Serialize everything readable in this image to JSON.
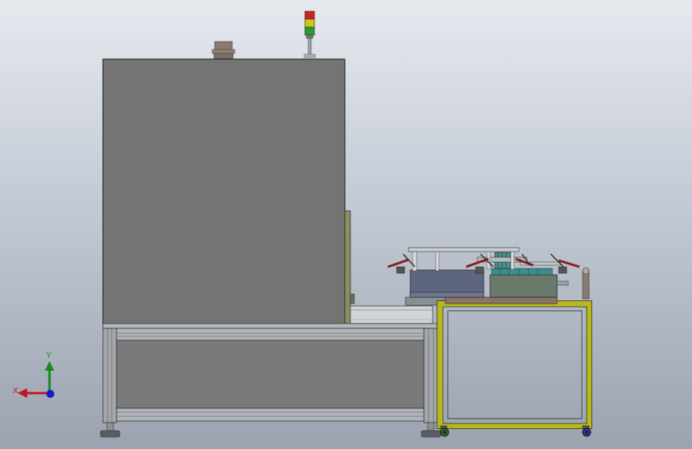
{
  "viewport": {
    "background_top": "#e6e9ee",
    "background_bottom": "#9ba3b0"
  },
  "model": {
    "cabinet_color": "#747474",
    "frame_color": "#a4a8ac",
    "cart_frame_color": "#b8b81a",
    "signal_tower_colors": [
      "#cc2222",
      "#c8c81e",
      "#2e9a2e"
    ],
    "tray_color": "#5e6580",
    "module_color": "#6a7a6a"
  },
  "triad": {
    "x_label": "X",
    "y_label": "Y",
    "x_color": "#c01818",
    "y_color": "#1a8a1a",
    "z_color": "#1818c8"
  }
}
